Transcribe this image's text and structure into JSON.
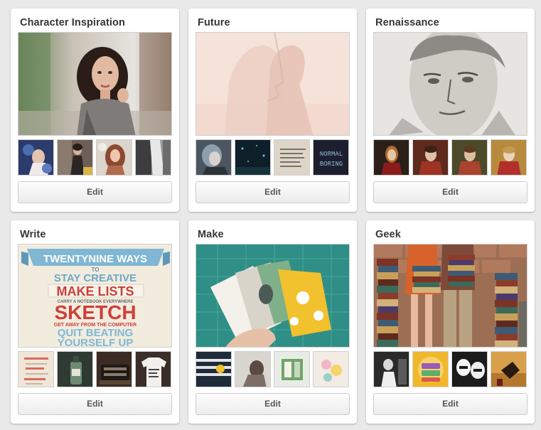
{
  "boards": [
    {
      "title": "Character Inspiration",
      "edit_label": "Edit"
    },
    {
      "title": "Future",
      "edit_label": "Edit",
      "thumb4_line1": "NORMAL",
      "thumb4_line2": "BORING"
    },
    {
      "title": "Renaissance",
      "edit_label": "Edit"
    },
    {
      "title": "Write",
      "edit_label": "Edit",
      "poster": {
        "line1": "TWENTYNINE WAYS",
        "line2": "TO",
        "line3": "STAY CREATIVE",
        "line4": "MAKE LISTS",
        "line5": "CARRY A NOTEBOOK EVERYWHERE",
        "line6": "SKETCH",
        "line7": "GET AWAY FROM THE COMPUTER",
        "line8": "QUIT BEATING",
        "line9": "YOURSELF UP"
      }
    },
    {
      "title": "Make",
      "edit_label": "Edit"
    },
    {
      "title": "Geek",
      "edit_label": "Edit"
    }
  ]
}
